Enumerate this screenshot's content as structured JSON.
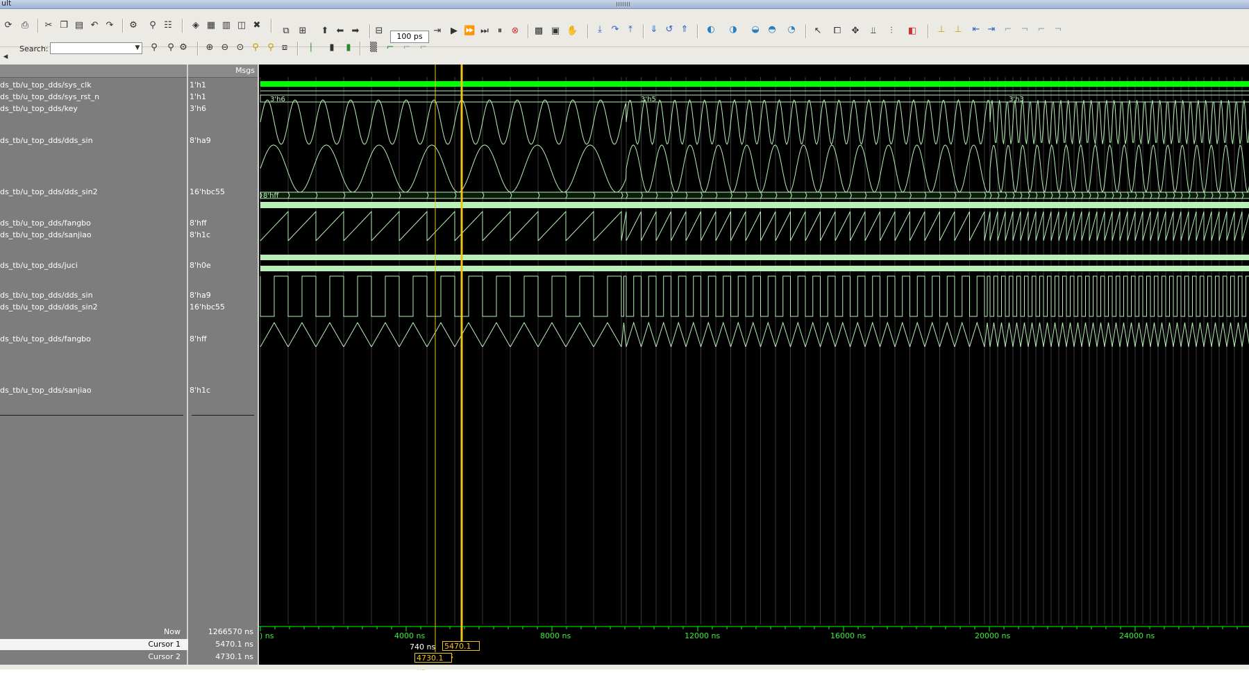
{
  "window": {
    "title_fragment": "ult"
  },
  "toolbar": {
    "zoom_value": "100 ps",
    "search_label": "Search:",
    "search_value": ""
  },
  "columns": {
    "msgs_header": "Msgs"
  },
  "signals": [
    {
      "name": "ds_tb/u_top_dds/sys_clk",
      "value": "1'h1"
    },
    {
      "name": "ds_tb/u_top_dds/sys_rst_n",
      "value": "1'h1"
    },
    {
      "name": "ds_tb/u_top_dds/key",
      "value": "3'h6"
    },
    {
      "name": "ds_tb/u_top_dds/dds_sin",
      "value": "8'ha9"
    },
    {
      "name": "ds_tb/u_top_dds/dds_sin2",
      "value": "16'hbc55"
    },
    {
      "name": "ds_tb/u_top_dds/fangbo",
      "value": "8'hff"
    },
    {
      "name": "ds_tb/u_top_dds/sanjiao",
      "value": "8'h1c"
    },
    {
      "name": "ds_tb/u_top_dds/juci",
      "value": "8'h0e"
    },
    {
      "name": "ds_tb/u_top_dds/dds_sin",
      "value": "8'ha9"
    },
    {
      "name": "ds_tb/u_top_dds/dds_sin2",
      "value": "16'hbc55"
    },
    {
      "name": "ds_tb/u_top_dds/fangbo",
      "value": "8'hff"
    },
    {
      "name": "ds_tb/u_top_dds/sanjiao",
      "value": "8'h1c"
    }
  ],
  "waveform": {
    "key_labels": [
      "3'h6",
      "3'h5",
      "3'h3"
    ],
    "fangbo_bus_label": "8'hff"
  },
  "footer": {
    "now_label": "Now",
    "now_value": "1266570 ns",
    "cursor1_label": "Cursor 1",
    "cursor1_value": "5470.1 ns",
    "cursor2_label": "Cursor 2",
    "cursor2_value": "4730.1 ns",
    "delta": "740 ns",
    "cursor1_tag": "5470.1 ns",
    "cursor2_tag": "4730.1 ns"
  },
  "timeline": {
    "start_label": ") ns",
    "ticks": [
      "4000 ns",
      "8000 ns",
      "12000 ns",
      "16000 ns",
      "20000 ns",
      "24000 ns"
    ]
  },
  "colors": {
    "wave_green": "#b8f0b8",
    "clk_green": "#00ff00",
    "cursor_yellow": "#f2c41a",
    "grid": "#3a3a3a"
  }
}
